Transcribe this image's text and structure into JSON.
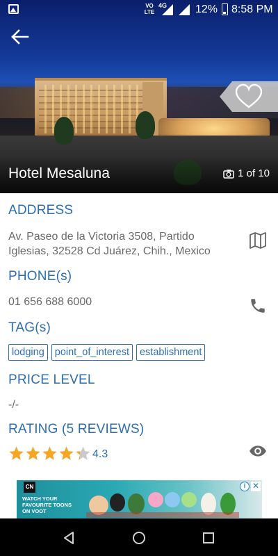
{
  "status_bar": {
    "volte": "VO LTE",
    "network": "4G",
    "battery": "12%",
    "time": "8:58 PM"
  },
  "hero": {
    "title": "Hotel Mesaluna",
    "photo_count": "1 of 10"
  },
  "address": {
    "heading": "ADDRESS",
    "text": "Av. Paseo de la Victoria 3508, Partido Iglesias, 32528 Cd Juárez, Chih., Mexico"
  },
  "phone": {
    "heading": "PHONE(s)",
    "number": "01 656 688 6000"
  },
  "tags": {
    "heading": "TAG(s)",
    "items": [
      "lodging",
      "point_of_interest",
      "establishment"
    ]
  },
  "price": {
    "heading": "PRICE LEVEL",
    "value": "-/-"
  },
  "rating": {
    "heading": "RATING (5 REVIEWS)",
    "value": "4.3",
    "stars": 4.3
  },
  "ad": {
    "logo": "CN",
    "copy": "WATCH YOUR FAVOURITE TOONS ON VOOT"
  },
  "colors": {
    "accent": "#2d6eb0",
    "star": "#f5a623",
    "text_gray": "#6a6a6a"
  }
}
